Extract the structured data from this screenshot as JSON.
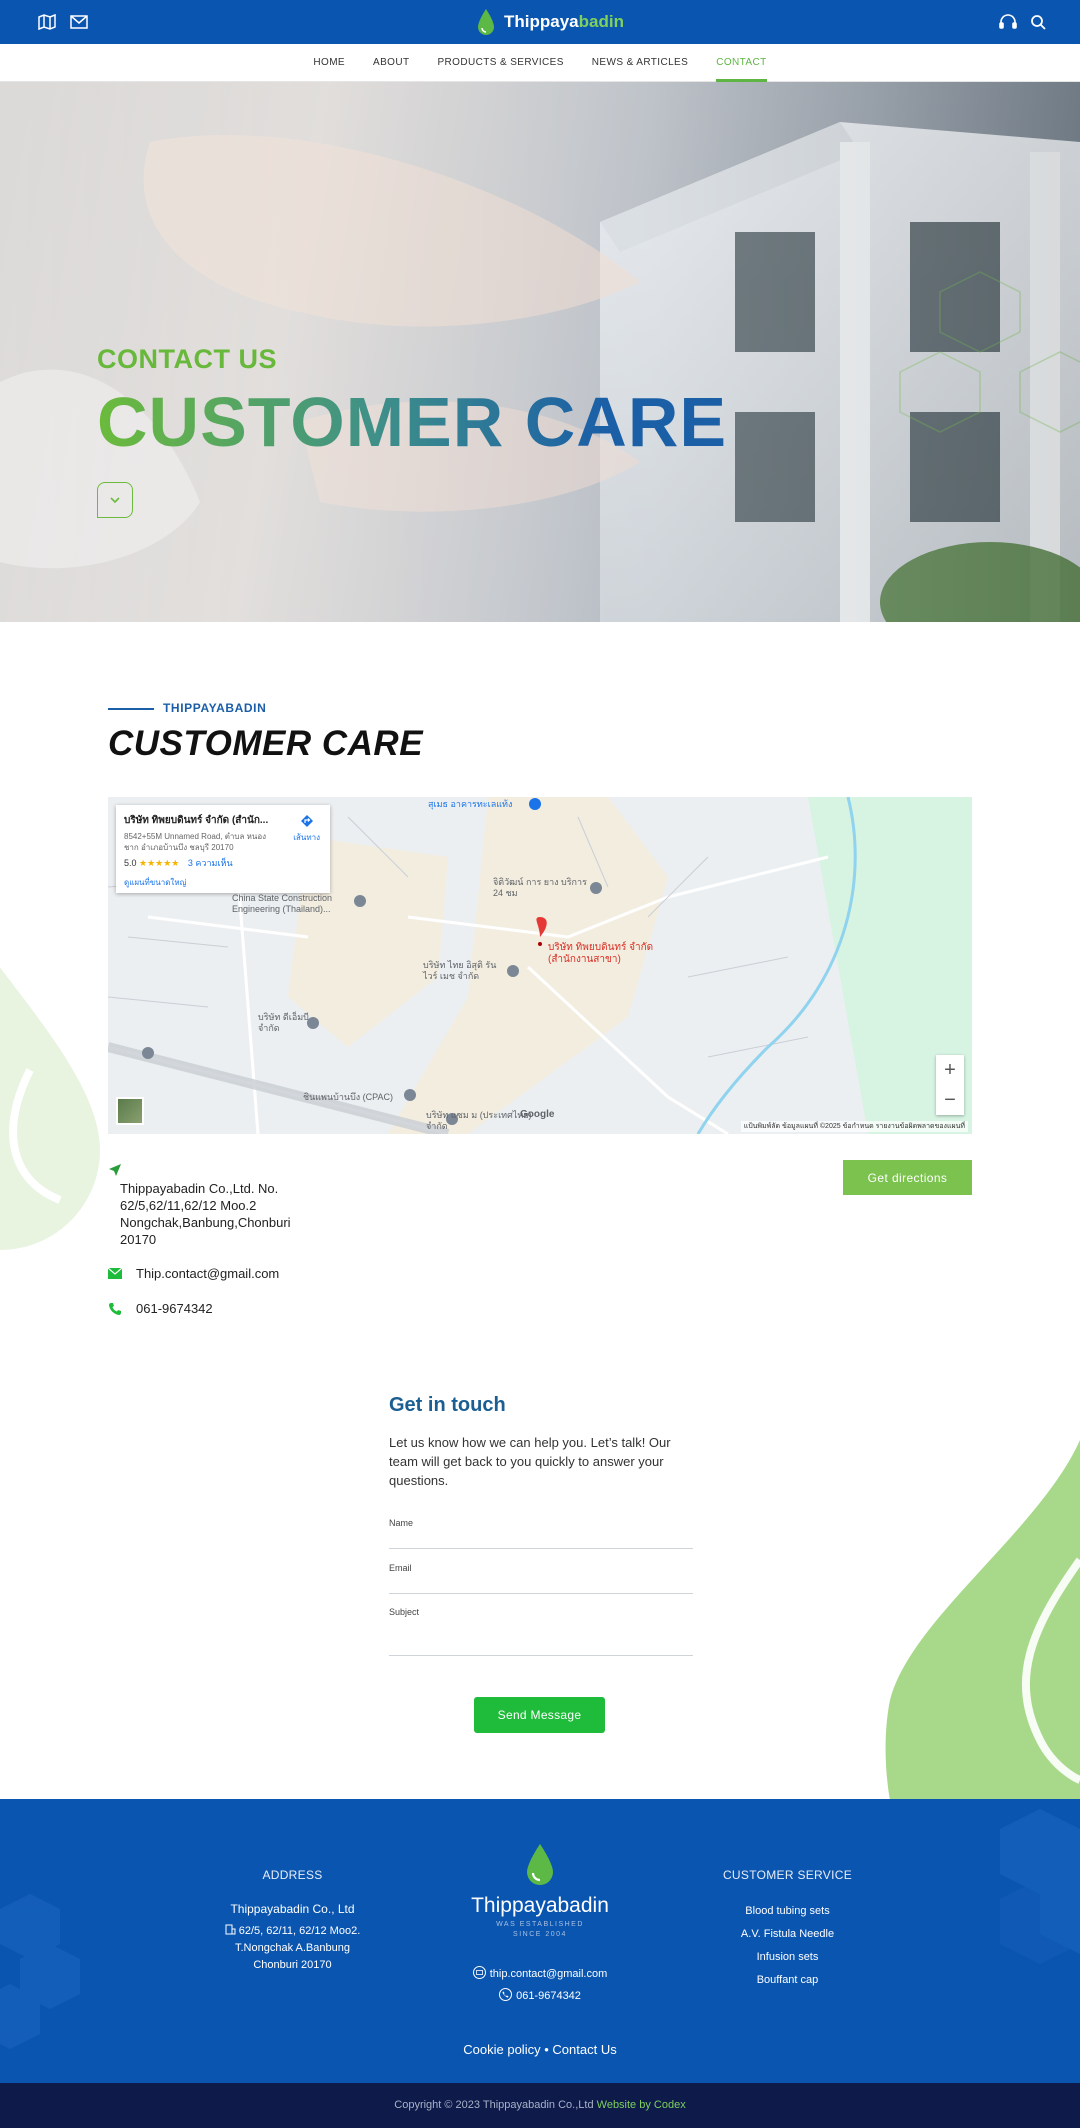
{
  "topbar": {
    "brand_part1": "Thippaya",
    "brand_part2": "badin",
    "icons": [
      "map-icon",
      "mail-icon",
      "headset-icon",
      "search-icon"
    ]
  },
  "nav": {
    "items": [
      {
        "label": "HOME"
      },
      {
        "label": "ABOUT"
      },
      {
        "label": "PRODUCTS & SERVICES"
      },
      {
        "label": "NEWS & ARTICLES"
      },
      {
        "label": "CONTACT"
      }
    ],
    "active_color": "#5fb544"
  },
  "hero": {
    "eyebrow": "CONTACT US",
    "title": "CUSTOMER CARE"
  },
  "section": {
    "eyebrow": "THIPPAYABADIN",
    "title": "CUSTOMER CARE"
  },
  "map": {
    "place_name": "บริษัท ทิพยบดินทร์ จำกัด (สำนัก...",
    "place_address": "8542+55M Unnamed Road, ตำบล หนองชาก อำเภอบ้านบึง ชลบุรี 20170",
    "rating": "5.0",
    "stars": "★★★★★",
    "reviews": "3 ความเห็น",
    "larger_map": "ดูแผนที่ขนาดใหญ่",
    "directions": "เส้นทาง",
    "marker_label": "บริษัท ทิพยบดินทร์ จำกัด (สำนักงานสาขา)",
    "labels": [
      {
        "text": "สุเมธ อาคารทะเลแท้ง"
      },
      {
        "text": "China State Construction Engineering (Thailand)..."
      },
      {
        "text": "จิติวัฒน์ การ ยาง บริการ 24 ชม"
      },
      {
        "text": "บริษัท ไทย อิสุติ รัน ไวร์ เมช จำกัด"
      },
      {
        "text": "บริษัท ดีเอ็มบี จำกัด"
      },
      {
        "text": "ชินแพนบ้านบึง (CPAC)"
      },
      {
        "text": "บริษัท แซม ม (ประเทศไทย) จำกัด"
      }
    ],
    "zoom_in": "+",
    "zoom_out": "−",
    "attribution": "แป้นพิมพ์ลัด   ข้อมูลแผนที่ ©2025   ข้อกำหนด   รายงานข้อผิดพลาดของแผนที่",
    "google": "Google"
  },
  "contact": {
    "address_lines": [
      "Thippayabadin Co.,Ltd. No.",
      "62/5,62/11,62/12 Moo.2",
      "Nongchak,Banbung,Chonburi",
      "20170"
    ],
    "email": "Thip.contact@gmail.com",
    "phone": "061-9674342",
    "get_directions": "Get directions"
  },
  "form": {
    "title": "Get in touch",
    "description": "Let us know how we can help you. Let’s talk! Our team will get back to you quickly to answer your questions.",
    "name_label": "Name",
    "email_label": "Email",
    "subject_label": "Subject",
    "send": "Send Message"
  },
  "footer": {
    "address_head": "ADDRESS",
    "address_company": "Thippayabadin Co., Ltd",
    "address_line1": "62/5, 62/11, 62/12 Moo2.",
    "address_line2": "T.Nongchak A.Banbung",
    "address_line3": "Chonburi 20170",
    "brand_part1": "Thippaya",
    "brand_part2": "badin",
    "was_established": "WAS ESTABLISHED",
    "since": "SINCE 2004",
    "email": "thip.contact@gmail.com",
    "phone": "061-9674342",
    "cs_head": "CUSTOMER SERVICE",
    "cs_items": [
      "Blood tubing sets",
      "A.V. Fistula Needle",
      "Infusion sets",
      "Bouffant cap"
    ],
    "cookie": "Cookie policy",
    "separator": "•",
    "contact_us": "Contact Us"
  },
  "copyright": {
    "text": "Copyright © 2023 Thippayabadin Co.,Ltd ",
    "by": "Website by Codex"
  },
  "colors": {
    "primary_blue": "#0a55b0",
    "green": "#7bc24e",
    "send_green": "#1fbb3a",
    "dark_navy": "#0d1a4a"
  }
}
